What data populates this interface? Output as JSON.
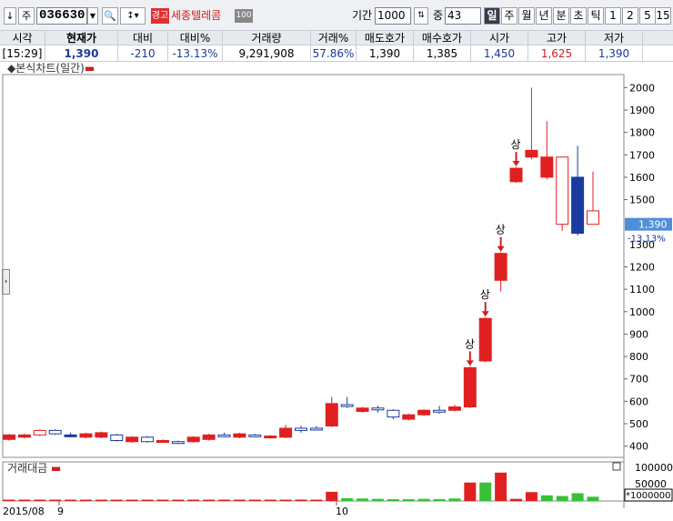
{
  "toolbar": {
    "down_icon": "↓",
    "market_label": "주",
    "code": "036630",
    "warn_label": "경고",
    "stock_name": "세종텔레콤",
    "badge": "100",
    "period_label": "기간",
    "period_value": "1000",
    "zoom_label": "중",
    "zoom_value": "43",
    "periods": [
      "일",
      "주",
      "월",
      "년",
      "분",
      "초",
      "틱",
      "1",
      "2",
      "5",
      "15"
    ]
  },
  "quote": {
    "headers": [
      "시각",
      "현재가",
      "대비",
      "대비%",
      "거래량",
      "거래%",
      "매도호가",
      "매수호가",
      "시가",
      "고가",
      "저가"
    ],
    "values": [
      "[15:29]",
      "1,390",
      "-210",
      "-13.13%",
      "9,291,908",
      "57.86%",
      "1,390",
      "1,385",
      "1,450",
      "1,625",
      "1,390"
    ]
  },
  "chart": {
    "title": "본식차트(일간)",
    "volume_title": "거래대금",
    "current_price_label": "1,390",
    "current_change_label": "-13.13%",
    "limit_up_label": "상",
    "x_labels": [
      "2015/08",
      "9",
      "10"
    ],
    "vol_axis": [
      "100000",
      "50000"
    ],
    "vol_unit": "*1000000"
  },
  "chart_data": {
    "type": "candlestick",
    "y_ticks": [
      400,
      500,
      600,
      700,
      800,
      900,
      1000,
      1100,
      1200,
      1300,
      1400,
      1500,
      1600,
      1700,
      1800,
      1900,
      2000
    ],
    "ylim": [
      350,
      2050
    ],
    "candles": [
      {
        "o": 430,
        "c": 450,
        "h": 455,
        "l": 425
      },
      {
        "o": 440,
        "c": 450,
        "h": 455,
        "l": 435
      },
      {
        "o": 450,
        "c": 470,
        "h": 475,
        "l": 445
      },
      {
        "o": 470,
        "c": 455,
        "h": 475,
        "l": 450
      },
      {
        "o": 450,
        "c": 445,
        "h": 460,
        "l": 440
      },
      {
        "o": 440,
        "c": 455,
        "h": 460,
        "l": 435
      },
      {
        "o": 440,
        "c": 460,
        "h": 465,
        "l": 435
      },
      {
        "o": 450,
        "c": 425,
        "h": 455,
        "l": 420
      },
      {
        "o": 420,
        "c": 440,
        "h": 445,
        "l": 415
      },
      {
        "o": 440,
        "c": 420,
        "h": 445,
        "l": 415
      },
      {
        "o": 420,
        "c": 425,
        "h": 430,
        "l": 415
      },
      {
        "o": 420,
        "c": 415,
        "h": 425,
        "l": 410
      },
      {
        "o": 420,
        "c": 440,
        "h": 445,
        "l": 415
      },
      {
        "o": 430,
        "c": 450,
        "h": 455,
        "l": 425
      },
      {
        "o": 450,
        "c": 445,
        "h": 460,
        "l": 440
      },
      {
        "o": 440,
        "c": 455,
        "h": 460,
        "l": 435
      },
      {
        "o": 450,
        "c": 445,
        "h": 455,
        "l": 440
      },
      {
        "o": 440,
        "c": 445,
        "h": 450,
        "l": 435
      },
      {
        "o": 440,
        "c": 480,
        "h": 495,
        "l": 435
      },
      {
        "o": 480,
        "c": 470,
        "h": 490,
        "l": 460
      },
      {
        "o": 480,
        "c": 475,
        "h": 490,
        "l": 470
      },
      {
        "o": 490,
        "c": 590,
        "h": 620,
        "l": 485
      },
      {
        "o": 585,
        "c": 580,
        "h": 620,
        "l": 570
      },
      {
        "o": 555,
        "c": 570,
        "h": 575,
        "l": 550
      },
      {
        "o": 570,
        "c": 565,
        "h": 580,
        "l": 550
      },
      {
        "o": 560,
        "c": 530,
        "h": 565,
        "l": 520
      },
      {
        "o": 520,
        "c": 540,
        "h": 545,
        "l": 515
      },
      {
        "o": 540,
        "c": 560,
        "h": 565,
        "l": 535
      },
      {
        "o": 560,
        "c": 555,
        "h": 580,
        "l": 545
      },
      {
        "o": 560,
        "c": 575,
        "h": 585,
        "l": 555
      },
      {
        "o": 575,
        "c": 750,
        "h": 755,
        "l": 570
      },
      {
        "o": 780,
        "c": 970,
        "h": 975,
        "l": 775
      },
      {
        "o": 1140,
        "c": 1260,
        "h": 1265,
        "l": 1090
      },
      {
        "o": 1580,
        "c": 1640,
        "h": 1645,
        "l": 1575
      },
      {
        "o": 1690,
        "c": 1720,
        "h": 2000,
        "l": 1680
      },
      {
        "o": 1600,
        "c": 1690,
        "h": 1850,
        "l": 1590
      },
      {
        "o": 1390,
        "c": 1690,
        "h": 1690,
        "l": 1360
      },
      {
        "o": 1600,
        "c": 1350,
        "h": 1740,
        "l": 1340
      },
      {
        "o": 1390,
        "c": 1450,
        "h": 1625,
        "l": 1390
      }
    ],
    "up_colors": [
      "#e02020",
      "#e02020",
      "#ffffff",
      "#ffffff",
      "#e02020",
      "#e02020",
      "#e02020",
      "#ffffff",
      "#e02020",
      "#ffffff",
      "#e02020",
      "#ffffff",
      "#e02020",
      "#e02020",
      "#ffffff",
      "#e02020",
      "#ffffff",
      "#e02020",
      "#e02020",
      "#ffffff",
      "#ffffff",
      "#e02020",
      "#ffffff",
      "#e02020",
      "#ffffff",
      "#ffffff",
      "#e02020",
      "#e02020",
      "#ffffff",
      "#e02020",
      "#e02020",
      "#e02020",
      "#e02020",
      "#e02020",
      "#e02020",
      "#e02020",
      "#ffffff",
      "#e02020",
      "#ffffff"
    ],
    "volume": [
      1500,
      1200,
      1800,
      1500,
      1300,
      1400,
      1600,
      1300,
      1100,
      1200,
      1200,
      1100,
      1400,
      1500,
      1400,
      1300,
      1200,
      1500,
      2200,
      4000,
      2500,
      26000,
      8000,
      7000,
      6000,
      5000,
      5000,
      6000,
      5500,
      7000,
      52000,
      52000,
      80000,
      6000,
      25000,
      16000,
      14000,
      22000,
      12000
    ],
    "volume_colors": [
      "#e02020",
      "#e02020",
      "#e02020",
      "#e02020",
      "#e02020",
      "#e02020",
      "#e02020",
      "#e02020",
      "#e02020",
      "#e02020",
      "#e02020",
      "#e02020",
      "#e02020",
      "#e02020",
      "#e02020",
      "#e02020",
      "#e02020",
      "#e02020",
      "#e02020",
      "#e02020",
      "#e02020",
      "#e02020",
      "#38c038",
      "#38c038",
      "#38c038",
      "#38c038",
      "#38c038",
      "#38c038",
      "#38c038",
      "#38c038",
      "#e02020",
      "#38c038",
      "#e02020",
      "#e02020",
      "#e02020",
      "#38c038",
      "#38c038",
      "#38c038",
      "#38c038"
    ],
    "limit_up_days": [
      30,
      31,
      32,
      33
    ]
  }
}
